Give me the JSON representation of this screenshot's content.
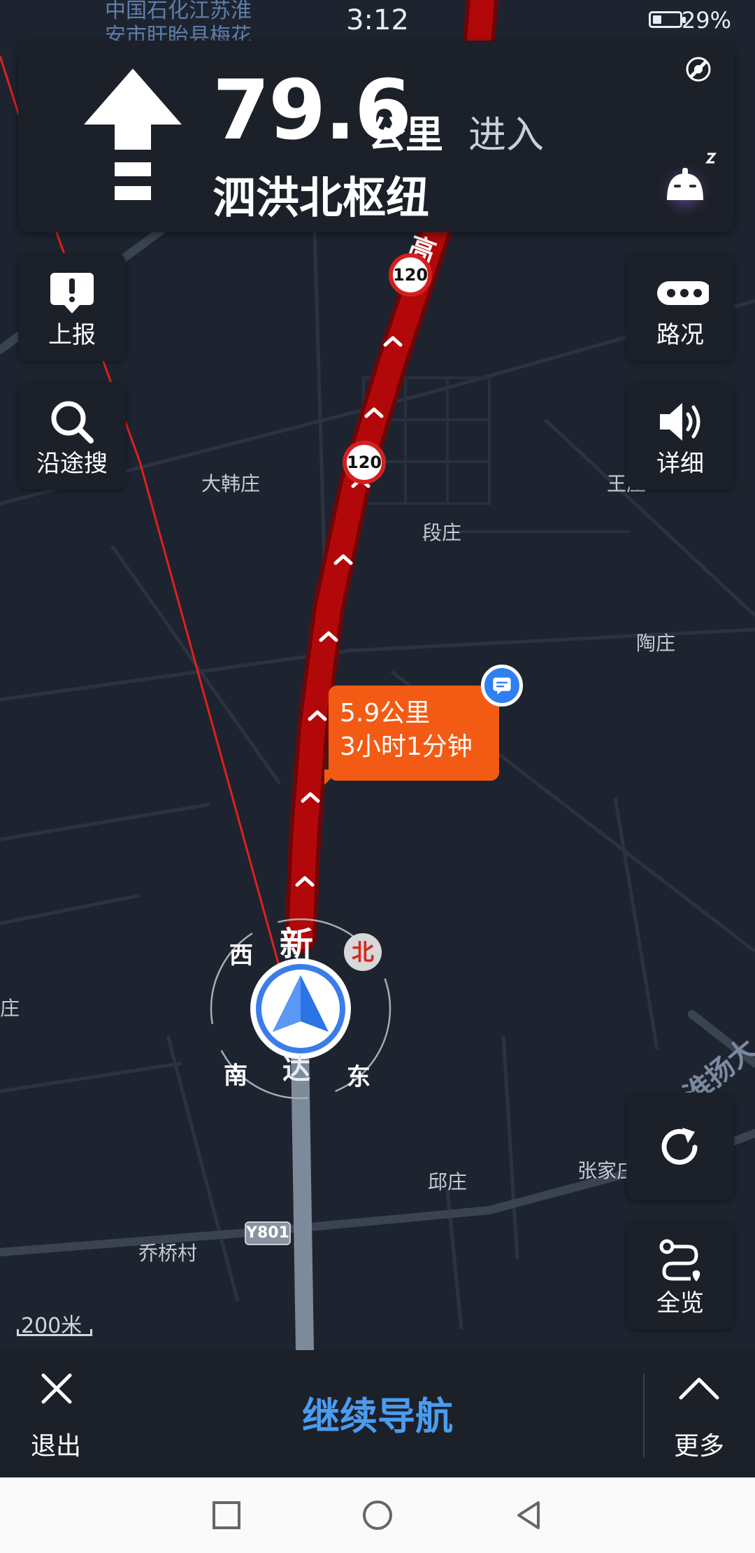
{
  "status": {
    "time": "3:12",
    "battery_pct": "29%",
    "battery_level": 0.29
  },
  "guidance": {
    "distance": "79.6",
    "unit": "公里",
    "action": "进入",
    "road": "泗洪北枢纽"
  },
  "left_buttons": {
    "report": "上报",
    "search_along": "沿途搜"
  },
  "right_buttons": {
    "traffic": "路况",
    "detail": "详细",
    "overview": "全览"
  },
  "map": {
    "top_labels": [
      "中国石化江苏淮",
      "安市盱眙县梅花"
    ],
    "places": [
      "大韩庄",
      "段庄",
      "王庄",
      "陶庄",
      "邱庄",
      "张家庄",
      "乔桥村",
      "庄"
    ],
    "road_labels": [
      "高",
      "淮扬大"
    ],
    "road_name_vertical": [
      "新",
      "达"
    ],
    "speed_limit": "120",
    "road_code": "Y801",
    "scale": "200米"
  },
  "route_bubble": {
    "distance": "5.9公里",
    "time": "3小时1分钟"
  },
  "compass": {
    "west": "西",
    "north": "北",
    "south": "南",
    "east": "东"
  },
  "bottom": {
    "exit": "退出",
    "continue": "继续导航",
    "more": "更多"
  },
  "colors": {
    "route_red": "#b3080a",
    "bubble_orange": "#f35a14",
    "accent_blue": "#4a9cf0",
    "panel_bg": "#1c2028"
  }
}
